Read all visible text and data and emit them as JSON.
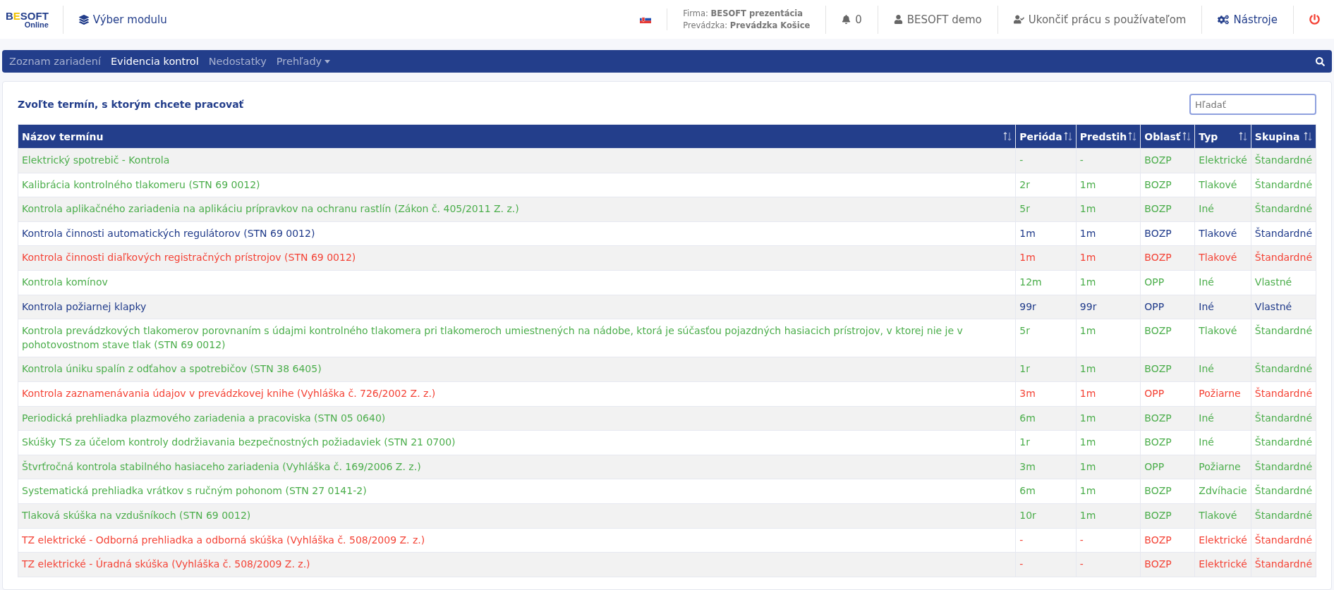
{
  "header": {
    "logo": {
      "name": "BESOFT",
      "sub": "Online"
    },
    "module": "Výber modulu",
    "company": {
      "firma_label": "Firma:",
      "firma": "BESOFT prezentácia",
      "prevadzka_label": "Prevádzka:",
      "prevadzka": "Prevádzka Košice"
    },
    "notifications": "0",
    "user": "BESOFT demo",
    "logout_user": "Ukončiť prácu s používateľom",
    "tools": "Nástroje"
  },
  "nav": [
    {
      "label": "Zoznam zariadení",
      "selected": false,
      "kind": "link"
    },
    {
      "label": "Evidencia kontrol",
      "selected": true,
      "kind": "link"
    },
    {
      "label": "Nedostatky",
      "selected": false,
      "kind": "link"
    },
    {
      "label": "Prehľady",
      "selected": false,
      "kind": "dropdown"
    }
  ],
  "panel": {
    "title": "Zvoľte termín, s ktorým chcete pracovať",
    "search": {
      "placeholder": "Hľadať"
    }
  },
  "table": {
    "columns": [
      "Názov termínu",
      "Perióda",
      "Predstih",
      "Oblasť",
      "Typ",
      "Skupina"
    ],
    "rows": [
      {
        "color": "#4cae4c",
        "cells": [
          "Elektrický spotrebič - Kontrola",
          "-",
          "-",
          "BOZP",
          "Elektrické",
          "Štandardné"
        ]
      },
      {
        "color": "#4cae4c",
        "cells": [
          "Kalibrácia kontrolného tlakomeru (STN 69 0012)",
          "2r",
          "1m",
          "BOZP",
          "Tlakové",
          "Štandardné"
        ]
      },
      {
        "color": "#4cae4c",
        "cells": [
          "Kontrola aplikačného zariadenia na aplikáciu prípravkov na ochranu rastlín (Zákon č. 405/2011 Z. z.)",
          "5r",
          "1m",
          "BOZP",
          "Iné",
          "Štandardné"
        ]
      },
      {
        "color": "#1f3a8a",
        "cells": [
          "Kontrola činnosti automatických regulátorov (STN 69 0012)",
          "1m",
          "1m",
          "BOZP",
          "Tlakové",
          "Štandardné"
        ]
      },
      {
        "color": "#f44336",
        "cells": [
          "Kontrola činnosti diaľkových registračných prístrojov (STN 69 0012)",
          "1m",
          "1m",
          "BOZP",
          "Tlakové",
          "Štandardné"
        ]
      },
      {
        "color": "#4cae4c",
        "cells": [
          "Kontrola komínov",
          "12m",
          "1m",
          "OPP",
          "Iné",
          "Vlastné"
        ]
      },
      {
        "color": "#1f3a8a",
        "cells": [
          "Kontrola požiarnej klapky",
          "99r",
          "99r",
          "OPP",
          "Iné",
          "Vlastné"
        ]
      },
      {
        "color": "#4cae4c",
        "cells": [
          "Kontrola prevádzkových tlakomerov porovnaním s údajmi kontrolného tlakomera pri tlakomeroch umiestnených na nádobe, ktorá je súčasťou pojazdných hasiacich prístrojov, v ktorej nie je v pohotovostnom stave tlak (STN 69 0012)",
          "5r",
          "1m",
          "BOZP",
          "Tlakové",
          "Štandardné"
        ]
      },
      {
        "color": "#4cae4c",
        "cells": [
          "Kontrola úniku spalín z odťahov a spotrebičov (STN 38 6405)",
          "1r",
          "1m",
          "BOZP",
          "Iné",
          "Štandardné"
        ]
      },
      {
        "color": "#f44336",
        "cells": [
          "Kontrola zaznamenávania údajov v prevádzkovej knihe (Vyhláška č. 726/2002 Z. z.)",
          "3m",
          "1m",
          "OPP",
          "Požiarne",
          "Štandardné"
        ]
      },
      {
        "color": "#4cae4c",
        "cells": [
          "Periodická prehliadka plazmového zariadenia a pracoviska (STN 05 0640)",
          "6m",
          "1m",
          "BOZP",
          "Iné",
          "Štandardné"
        ]
      },
      {
        "color": "#4cae4c",
        "cells": [
          "Skúšky TS za účelom kontroly dodržiavania bezpečnostných požiadaviek (STN 21 0700)",
          "1r",
          "1m",
          "BOZP",
          "Iné",
          "Štandardné"
        ]
      },
      {
        "color": "#4cae4c",
        "cells": [
          "Štvrťročná kontrola stabilného hasiaceho zariadenia (Vyhláška č. 169/2006 Z. z.)",
          "3m",
          "1m",
          "OPP",
          "Požiarne",
          "Štandardné"
        ]
      },
      {
        "color": "#4cae4c",
        "cells": [
          "Systematická prehliadka vrátkov s ručným pohonom (STN 27 0141-2)",
          "6m",
          "1m",
          "BOZP",
          "Zdvíhacie",
          "Štandardné"
        ]
      },
      {
        "color": "#4cae4c",
        "cells": [
          "Tlaková skúška na vzdušníkoch (STN 69 0012)",
          "10r",
          "1m",
          "BOZP",
          "Tlakové",
          "Štandardné"
        ]
      },
      {
        "color": "#f44336",
        "cells": [
          "TZ elektrické - Odborná prehliadka a odborná skúška (Vyhláška č. 508/2009 Z. z.)",
          "-",
          "-",
          "BOZP",
          "Elektrické",
          "Štandardné"
        ]
      },
      {
        "color": "#f44336",
        "cells": [
          "TZ elektrické - Úradná skúška (Vyhláška č. 508/2009 Z. z.)",
          "-",
          "-",
          "BOZP",
          "Elektrické",
          "Štandardné"
        ]
      }
    ]
  }
}
